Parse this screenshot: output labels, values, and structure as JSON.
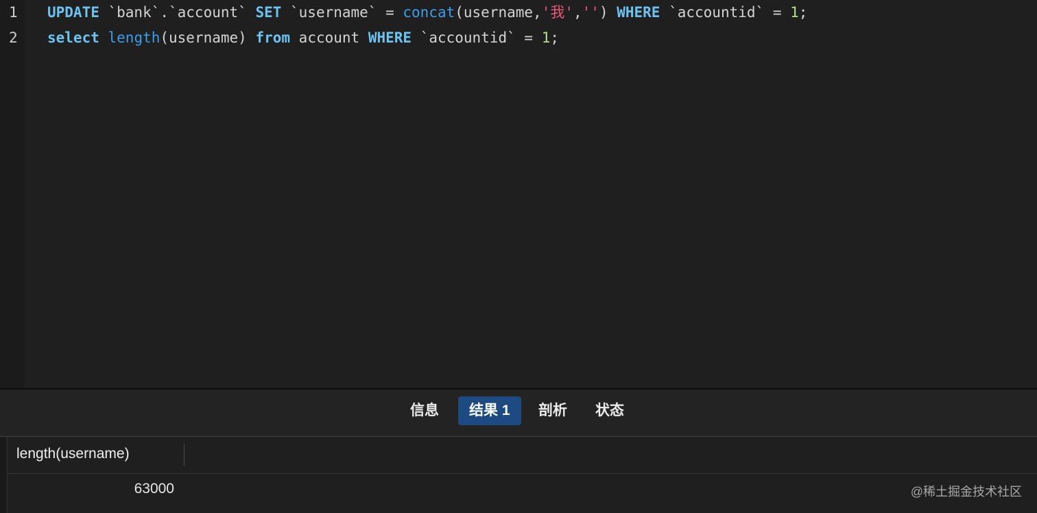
{
  "editor": {
    "line_numbers": [
      "1",
      "2"
    ],
    "lines": [
      [
        {
          "t": "UPDATE",
          "c": "kw"
        },
        {
          "t": " `bank`.`account` ",
          "c": "txt"
        },
        {
          "t": "SET",
          "c": "kw"
        },
        {
          "t": " `username` = ",
          "c": "txt"
        },
        {
          "t": "concat",
          "c": "fn"
        },
        {
          "t": "(username,",
          "c": "txt"
        },
        {
          "t": "'我'",
          "c": "str"
        },
        {
          "t": ",",
          "c": "txt"
        },
        {
          "t": "''",
          "c": "str"
        },
        {
          "t": ") ",
          "c": "txt"
        },
        {
          "t": "WHERE",
          "c": "kw"
        },
        {
          "t": " `accountid` = ",
          "c": "txt"
        },
        {
          "t": "1",
          "c": "num"
        },
        {
          "t": ";",
          "c": "txt"
        }
      ],
      [
        {
          "t": "select",
          "c": "kw"
        },
        {
          "t": " ",
          "c": "txt"
        },
        {
          "t": "length",
          "c": "fn"
        },
        {
          "t": "(username) ",
          "c": "txt"
        },
        {
          "t": "from",
          "c": "kw"
        },
        {
          "t": " account ",
          "c": "txt"
        },
        {
          "t": "WHERE",
          "c": "kw"
        },
        {
          "t": " `accountid` = ",
          "c": "txt"
        },
        {
          "t": "1",
          "c": "num"
        },
        {
          "t": ";",
          "c": "txt"
        }
      ]
    ]
  },
  "tabs": {
    "info": "信息",
    "result1": "结果 1",
    "profile": "剖析",
    "status": "状态",
    "active": "result1"
  },
  "results": {
    "columns": [
      "length(username)"
    ],
    "rows": [
      [
        "63000"
      ]
    ]
  },
  "watermark": "@稀土掘金技术社区",
  "colors": {
    "background": "#1f1f1f",
    "keyword": "#6cc3f0",
    "function": "#3b9ee8",
    "string": "#e8587a",
    "number": "#b5e08a",
    "active_tab": "#1d4a80"
  }
}
